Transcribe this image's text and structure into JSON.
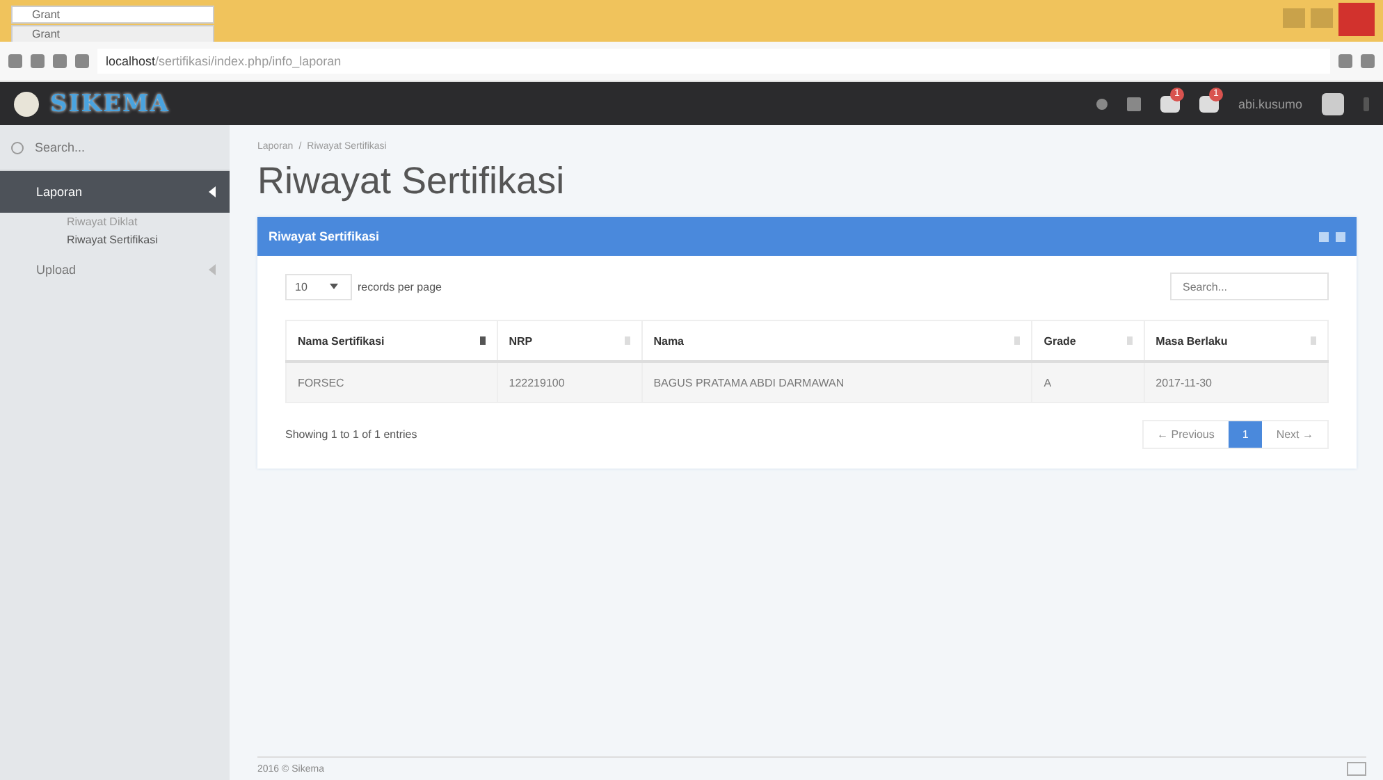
{
  "browser": {
    "tabs": [
      {
        "title": "Grant",
        "selected": true
      },
      {
        "title": "Grant",
        "selected": false
      }
    ],
    "url_host": "localhost",
    "url_path": "/sertifikasi/index.php/info_laporan"
  },
  "navbar": {
    "logo": "SIKEMA",
    "badges": [
      "1",
      "1"
    ],
    "user": "abi.kusumo"
  },
  "sidebar": {
    "search_placeholder": "Search...",
    "items": [
      {
        "label": "Laporan",
        "selected": true,
        "expanded": true,
        "children": [
          {
            "label": "Riwayat Diklat",
            "selected": false
          },
          {
            "label": "Riwayat Sertifikasi",
            "selected": true
          }
        ]
      },
      {
        "label": "Upload",
        "selected": false,
        "expanded": false
      }
    ]
  },
  "breadcrumb": {
    "separator": "/",
    "items": [
      "Laporan",
      "Riwayat Sertifikasi"
    ]
  },
  "page_title": "Riwayat Sertifikasi",
  "panel": {
    "title": "Riwayat Sertifikasi",
    "page_size": "10",
    "page_size_label": "records per page",
    "search_placeholder": "Search...",
    "table": {
      "columns": [
        {
          "label": "Nama Sertifikasi",
          "sorted": true
        },
        {
          "label": "NRP",
          "sorted": false
        },
        {
          "label": "Nama",
          "sorted": false
        },
        {
          "label": "Grade",
          "sorted": false
        },
        {
          "label": "Masa Berlaku",
          "sorted": false
        }
      ],
      "rows": [
        [
          "FORSEC",
          "122219100",
          "BAGUS PRATAMA ABDI DARMAWAN",
          "A",
          "2017-11-30"
        ]
      ]
    },
    "info": "Showing 1 to 1 of 1 entries",
    "pagination": [
      {
        "label": "← Previous",
        "selected": false
      },
      {
        "label": "1",
        "selected": true
      },
      {
        "label": "Next →",
        "selected": false
      }
    ]
  },
  "footer": "2016 © Sikema"
}
